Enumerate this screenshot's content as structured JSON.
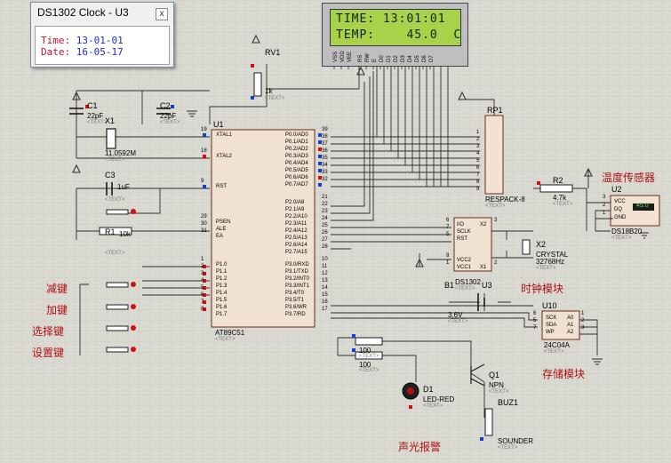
{
  "popup": {
    "title": "DS1302 Clock - U3",
    "close": "x",
    "time_label": "Time:",
    "time_value": "13-01-01",
    "date_label": "Date:",
    "date_value": "16-05-17"
  },
  "lcd": {
    "line1": "TIME: 13:01:01",
    "line2": "TEMP:    45.0  C",
    "pins": [
      "VSS",
      "VDD",
      "VEE",
      "RS",
      "RW",
      "E",
      "D0",
      "D1",
      "D2",
      "D3",
      "D4",
      "D5",
      "D6",
      "D7"
    ]
  },
  "refs": {
    "rv1": "RV1",
    "rv1_val": "1k",
    "c1": "C1",
    "c1_val": "22pF",
    "c2": "C2",
    "c2_val": "22pF",
    "x1": "X1",
    "x1_val": "11.0592M",
    "c3": "C3",
    "c3_val": "1uF",
    "r1": "R1",
    "r1_val": "10k",
    "u1": "U1",
    "u1_part": "AT89C51",
    "rp1": "RP1",
    "rp1_part": "RESPACK-8",
    "r2": "R2",
    "r2_val": "4.7k",
    "u2": "U2",
    "u2_part": "DS18B20",
    "u2_display": "45.0",
    "x2": "X2",
    "x2_part": "CRYSTAL",
    "x2_val": "32768Hz",
    "u3": "U3",
    "u3_part": "DS1302",
    "b1": "B1",
    "b1_val": "3.6V",
    "u10": "U10",
    "u10_part": "24C04A",
    "q1": "Q1",
    "q1_part": "NPN",
    "d1": "D1",
    "d1_part": "LED-RED",
    "buz1": "BUZ1",
    "buz1_part": "SOUNDER",
    "r100a": "100",
    "r100b": "100",
    "text_tag": "<TEXT>"
  },
  "labels": {
    "dec_key": "减键",
    "inc_key": "加键",
    "sel_key": "选择键",
    "set_key": "设置键",
    "temp_sensor": "温度传感器",
    "clock_module": "时钟模块",
    "storage_module": "存储模块",
    "alarm": "声光报警"
  },
  "u1_left_pins": [
    "XTAL1",
    "XTAL2",
    "RST",
    "PSEN",
    "ALE",
    "EA",
    "P1.0",
    "P1.1",
    "P1.2",
    "P1.3",
    "P1.4",
    "P1.5",
    "P1.6",
    "P1.7"
  ],
  "u1_left_nums": [
    "19",
    "18",
    "9",
    "29",
    "30",
    "31",
    "1",
    "2",
    "3",
    "4",
    "5",
    "6",
    "7",
    "8"
  ],
  "u1_right_pins": [
    "P0.0/AD0",
    "P0.1/AD1",
    "P0.2/AD2",
    "P0.3/AD3",
    "P0.4/AD4",
    "P0.5/AD5",
    "P0.6/AD6",
    "P0.7/AD7",
    "P2.0/A8",
    "P2.1/A9",
    "P2.2/A10",
    "P2.3/A11",
    "P2.4/A12",
    "P2.5/A13",
    "P2.6/A14",
    "P2.7/A15",
    "P3.0/RXD",
    "P3.1/TXD",
    "P3.2/INT0",
    "P3.3/INT1",
    "P3.4/T0",
    "P3.5/T1",
    "P3.6/WR",
    "P3.7/RD"
  ],
  "u1_right_nums": [
    "39",
    "38",
    "37",
    "36",
    "35",
    "34",
    "33",
    "32",
    "21",
    "22",
    "23",
    "24",
    "25",
    "26",
    "27",
    "28",
    "10",
    "11",
    "12",
    "13",
    "14",
    "15",
    "16",
    "17"
  ],
  "u3_pins": [
    "I/O",
    "SCLK",
    "RST",
    "VCC2",
    "VCC1",
    "X2",
    "X1"
  ],
  "u3_nums": [
    "6",
    "7",
    "5",
    "8",
    "1",
    "3",
    "2"
  ],
  "u10_pins": [
    "SCK",
    "SDA",
    "WP",
    "A0",
    "A1",
    "A2"
  ],
  "u10_nums": [
    "6",
    "5",
    "7",
    "1",
    "2",
    "3"
  ],
  "u2_pins": [
    "VCC",
    "DQ",
    "GND"
  ],
  "u2_nums": [
    "3",
    "2",
    "1"
  ],
  "rp1_nums": [
    "1",
    "2",
    "3",
    "4",
    "5",
    "6",
    "7",
    "8",
    "9"
  ]
}
